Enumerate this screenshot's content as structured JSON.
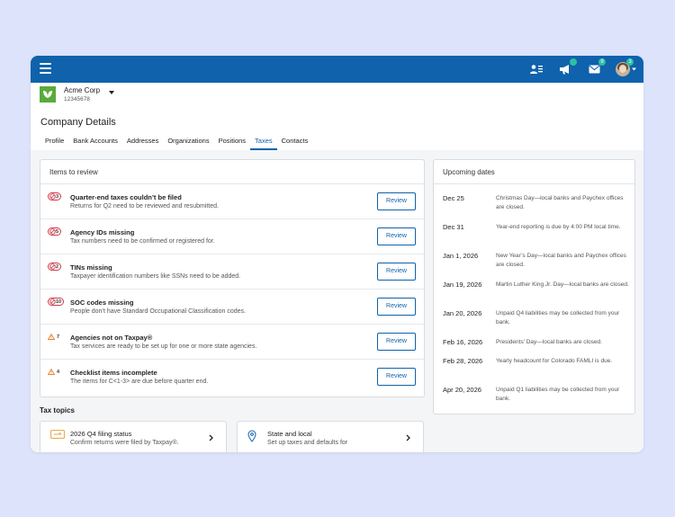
{
  "header": {
    "badges": {
      "megaphone": "",
      "mail": "9",
      "avatar": "3"
    }
  },
  "company": {
    "name": "Acme Corp",
    "id": "12345678"
  },
  "page": {
    "title": "Company Details",
    "tabs": [
      {
        "label": "Profile",
        "active": false
      },
      {
        "label": "Bank Accounts",
        "active": false
      },
      {
        "label": "Addresses",
        "active": false
      },
      {
        "label": "Organizations",
        "active": false
      },
      {
        "label": "Positions",
        "active": false
      },
      {
        "label": "Taxes",
        "active": true
      },
      {
        "label": "Contacts",
        "active": false
      }
    ]
  },
  "review": {
    "heading": "Items to review",
    "button_label": "Review",
    "items": [
      {
        "type": "error",
        "count": "3",
        "title": "Quarter-end taxes couldn’t be filed",
        "subtitle": "Returns for Q2 need to be reviewed and resubmitted."
      },
      {
        "type": "error",
        "count": "5",
        "title": "Agency IDs missing",
        "subtitle": "Tax numbers need to be confirmed or registered for."
      },
      {
        "type": "error",
        "count": "2",
        "title": "TINs missing",
        "subtitle": "Taxpayer identification numbers like SSNs need to be added."
      },
      {
        "type": "error",
        "count": "10",
        "title": "SOC codes missing",
        "subtitle": "People don’t have Standard Occupational Classification codes."
      },
      {
        "type": "warning",
        "count": "7",
        "title": "Agencies not on Taxpay®",
        "subtitle": "Tax services are ready to be set up for one or more state agencies."
      },
      {
        "type": "warning",
        "count": "4",
        "title": "Checklist items incomplete",
        "subtitle": "The items for C<1-3> are due before quarter end."
      }
    ]
  },
  "upcoming": {
    "heading": "Upcoming dates",
    "items": [
      {
        "date": "Dec 25",
        "desc": "Christmas Day—local banks and Paychex offices are closed."
      },
      {
        "date": "Dec 31",
        "desc": "Year-end reporting is due by 4:00 PM local time."
      },
      {
        "date": "Jan 1, 2026",
        "desc": "New Year’s Day—local banks and Paychex offices are closed."
      },
      {
        "date": "Jan 19, 2026",
        "desc": "Martin Luther King Jr. Day—local banks are closed."
      },
      {
        "date": "Jan 20, 2026",
        "desc": "Unpaid Q4 liabilities may be collected from your bank."
      },
      {
        "date": "Feb 16, 2026",
        "desc": "Presidents’ Day—local banks are closed."
      },
      {
        "date": "Feb 28, 2026",
        "desc": "Yearly headcount for Colorado FAMLI is due."
      },
      {
        "date": "Apr 20, 2026",
        "desc": "Unpaid Q1 liabilities may be collected from your bank."
      }
    ]
  },
  "topics": {
    "heading": "Tax topics",
    "items": [
      {
        "icon": "ticket-icon",
        "title": "2026 Q4 filing status",
        "subtitle": "Confirm returns were filed by Taxpay®."
      },
      {
        "icon": "map-pin-icon",
        "title": "State and local",
        "subtitle": "Set up taxes and defaults for"
      }
    ]
  },
  "colors": {
    "brand_blue": "#0f62ab",
    "error_red": "#d1394a",
    "warning_orange": "#e8832a",
    "notification_teal": "#2bbfa4",
    "logo_green": "#5aab3c",
    "page_background": "#dce3fb"
  }
}
